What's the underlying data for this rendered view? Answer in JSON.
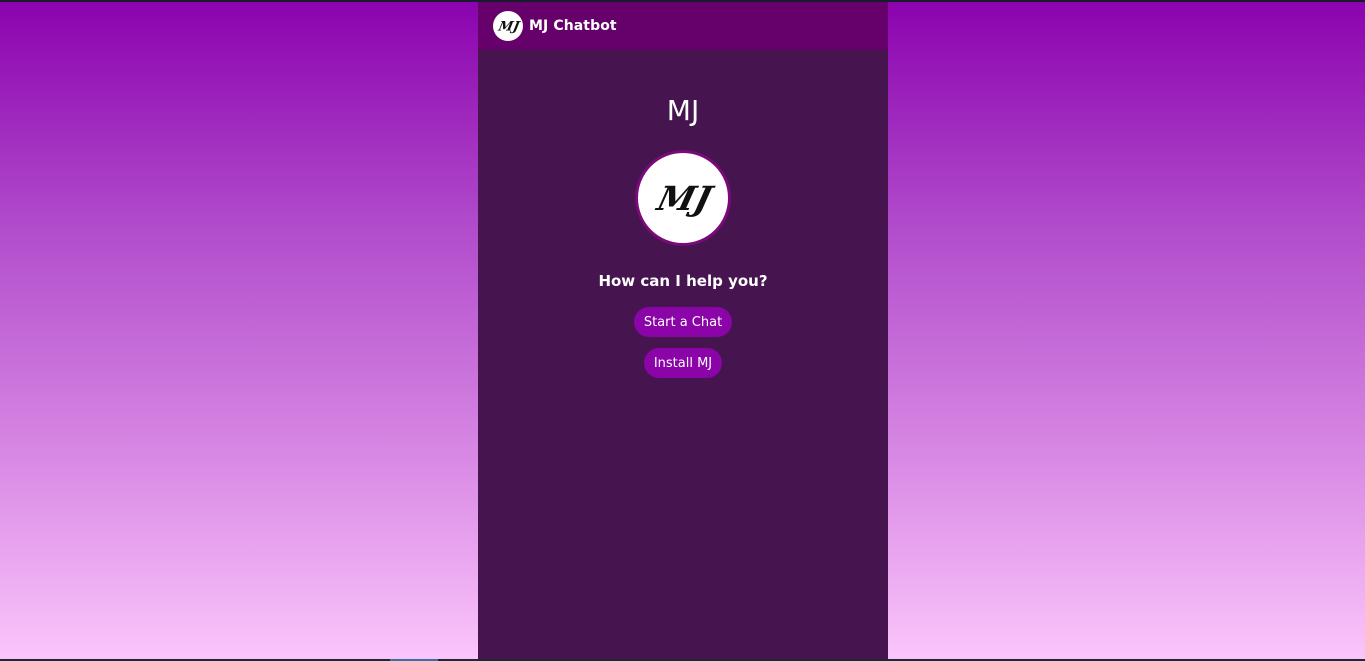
{
  "header": {
    "title": "MJ Chatbot",
    "logo_text": "MJ"
  },
  "main": {
    "bot_name": "MJ",
    "avatar_text": "MJ",
    "prompt": "How can I help you?",
    "buttons": {
      "start_chat": "Start a Chat",
      "install": "Install MJ"
    }
  },
  "colors": {
    "header_bg": "#66006a",
    "panel_bg": "#461550",
    "button_bg": "#8a04a8",
    "avatar_border": "#7a0a78",
    "gradient_top": "#8a02ae",
    "gradient_bottom": "#fbc6fb"
  }
}
